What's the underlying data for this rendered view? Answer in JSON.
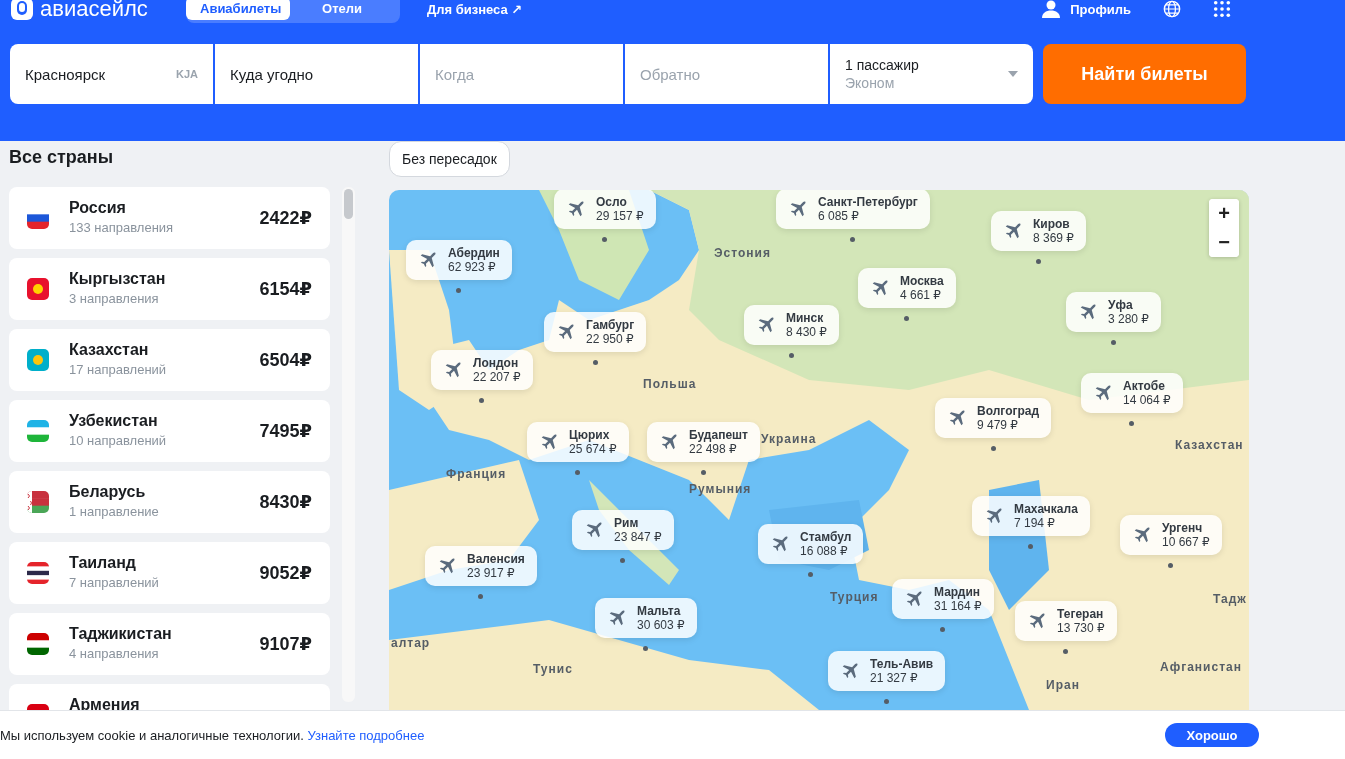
{
  "header": {
    "logo": "авиасейлс",
    "tabs": [
      {
        "label": "Авиабилеты",
        "selected": true
      },
      {
        "label": "Отели",
        "selected": false
      }
    ],
    "business_link": "Для бизнеса ↗",
    "profile": "Профиль"
  },
  "search": {
    "origin": {
      "value": "Красноярск",
      "code": "KJA"
    },
    "destination": {
      "value": "Куда угодно"
    },
    "depart": {
      "placeholder": "Когда"
    },
    "return": {
      "placeholder": "Обратно"
    },
    "passengers": {
      "value": "1 пассажир",
      "class": "Эконом"
    },
    "submit": "Найти билеты"
  },
  "sidebar": {
    "title": "Все страны",
    "countries": [
      {
        "name": "Россия",
        "count": "133 направления",
        "price": "2422₽"
      },
      {
        "name": "Кыргызстан",
        "count": "3 направления",
        "price": "6154₽"
      },
      {
        "name": "Казахстан",
        "count": "17 направлений",
        "price": "6504₽"
      },
      {
        "name": "Узбекистан",
        "count": "10 направлений",
        "price": "7495₽"
      },
      {
        "name": "Беларусь",
        "count": "1 направление",
        "price": "8430₽"
      },
      {
        "name": "Таиланд",
        "count": "7 направлений",
        "price": "9052₽"
      },
      {
        "name": "Таджикистан",
        "count": "4 направления",
        "price": "9107₽"
      },
      {
        "name": "Армения"
      }
    ]
  },
  "filter_chip": {
    "label": "Без пересадок",
    "selected": false
  },
  "map": {
    "destinations": [
      {
        "city": "Осло",
        "price": "29 157 ₽"
      },
      {
        "city": "Санкт-Петербург",
        "price": "6 085 ₽"
      },
      {
        "city": "Абердин",
        "price": "62 923 ₽"
      },
      {
        "city": "Киров",
        "price": "8 369 ₽"
      },
      {
        "city": "Москва",
        "price": "4 661 ₽"
      },
      {
        "city": "Минск",
        "price": "8 430 ₽"
      },
      {
        "city": "Гамбург",
        "price": "22 950 ₽"
      },
      {
        "city": "Уфа",
        "price": "3 280 ₽"
      },
      {
        "city": "Лондон",
        "price": "22 207 ₽"
      },
      {
        "city": "Актобе",
        "price": "14 064 ₽"
      },
      {
        "city": "Волгоград",
        "price": "9 479 ₽"
      },
      {
        "city": "Цюрих",
        "price": "25 674 ₽"
      },
      {
        "city": "Будапешт",
        "price": "22 498 ₽"
      },
      {
        "city": "Махачкала",
        "price": "7 194 ₽"
      },
      {
        "city": "Рим",
        "price": "23 847 ₽"
      },
      {
        "city": "Стамбул",
        "price": "16 088 ₽"
      },
      {
        "city": "Ургенч",
        "price": "10 667 ₽"
      },
      {
        "city": "Валенсия",
        "price": "23 917 ₽"
      },
      {
        "city": "Мардин",
        "price": "31 164 ₽"
      },
      {
        "city": "Мальта",
        "price": "30 603 ₽"
      },
      {
        "city": "Тегеран",
        "price": "13 730 ₽"
      },
      {
        "city": "Тель-Авив",
        "price": "21 327 ₽"
      }
    ],
    "labels": [
      "Эстония",
      "Польша",
      "Украина",
      "Казахстан",
      "Франция",
      "Румыния",
      "Турция",
      "Тадж",
      "алтар",
      "Тунис",
      "Афганистан",
      "Иран"
    ],
    "zoom_in": "+",
    "zoom_out": "−"
  },
  "cookie_banner": {
    "text": "Мы используем cookie и аналогичные технологии.",
    "link": "Узнайте подробнее",
    "button": "Хорошо"
  }
}
